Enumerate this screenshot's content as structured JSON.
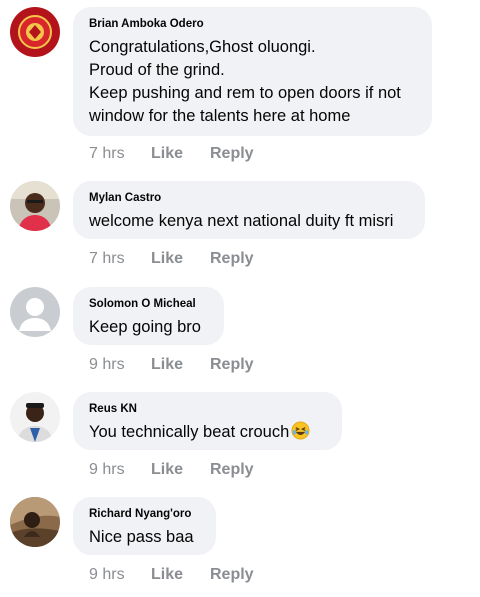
{
  "comments": [
    {
      "author": "Brian Amboka Odero",
      "text": "Congratulations,Ghost oluongi.\nProud of the grind.\nKeep pushing and rem to open doors if not\nwindow for the talents here at home",
      "time": "7 hrs",
      "like_label": "Like",
      "reply_label": "Reply"
    },
    {
      "author": "Mylan Castro",
      "text": "welcome kenya next national duity ft misri",
      "time": "7 hrs",
      "like_label": "Like",
      "reply_label": "Reply"
    },
    {
      "author": "Solomon O Micheal",
      "text": "Keep going bro",
      "time": "9 hrs",
      "like_label": "Like",
      "reply_label": "Reply"
    },
    {
      "author": "Reus KN",
      "text": "You technically beat crouch",
      "emoji": "laughing-emoji",
      "time": "9 hrs",
      "like_label": "Like",
      "reply_label": "Reply"
    },
    {
      "author": "Richard Nyang'oro",
      "text": "Nice pass baa",
      "time": "9 hrs",
      "like_label": "Like",
      "reply_label": "Reply"
    }
  ],
  "colors": {
    "bubble": "#f0f2f5",
    "text": "#050505",
    "meta": "#8a8d91"
  }
}
